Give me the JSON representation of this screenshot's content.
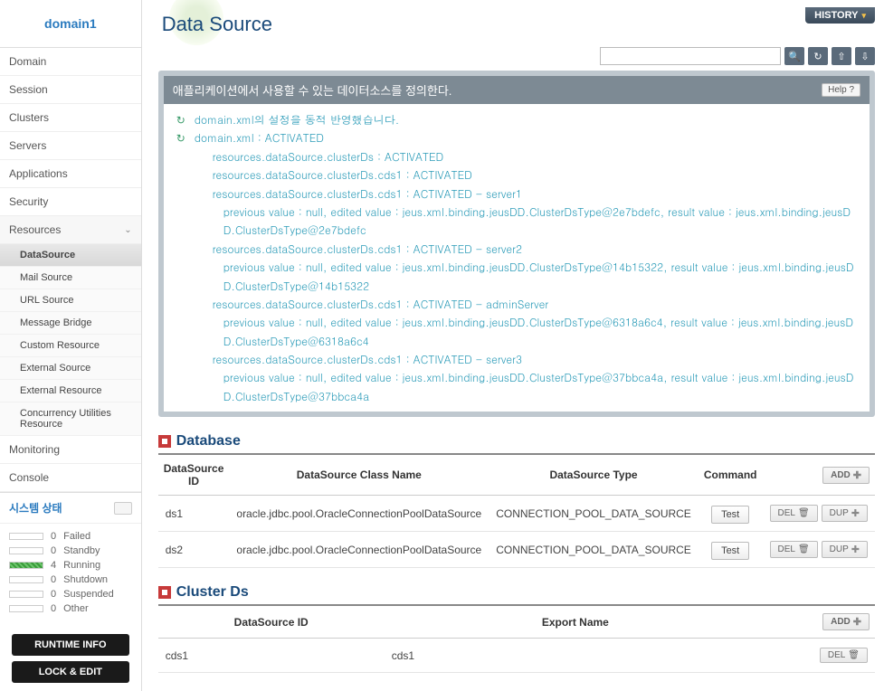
{
  "header": {
    "domain": "domain1",
    "page_title": "Data Source",
    "history": "HISTORY"
  },
  "nav": {
    "items": [
      "Domain",
      "Session",
      "Clusters",
      "Servers",
      "Applications",
      "Security",
      "Resources",
      "Monitoring",
      "Console"
    ],
    "resources_sub": [
      "DataSource",
      "Mail Source",
      "URL Source",
      "Message Bridge",
      "Custom Resource",
      "External Source",
      "External Resource",
      "Concurrency Utilities Resource"
    ]
  },
  "status": {
    "title": "시스템 상태",
    "rows": [
      {
        "count": "0",
        "label": "Failed"
      },
      {
        "count": "0",
        "label": "Standby"
      },
      {
        "count": "4",
        "label": "Running"
      },
      {
        "count": "0",
        "label": "Shutdown"
      },
      {
        "count": "0",
        "label": "Suspended"
      },
      {
        "count": "0",
        "label": "Other"
      }
    ],
    "runtime_btn": "RUNTIME INFO",
    "lock_btn": "LOCK & EDIT"
  },
  "panel": {
    "description": "애플리케이션에서 사용할 수 있는 데이터소스를 정의한다.",
    "help": "Help ?",
    "messages": [
      {
        "icon": true,
        "indent": 0,
        "text": "domain.xml의 설정을 동적 반영했습니다."
      },
      {
        "icon": true,
        "indent": 0,
        "text": "domain.xml : ACTIVATED"
      },
      {
        "icon": false,
        "indent": 1,
        "text": "resources.dataSource.clusterDs : ACTIVATED"
      },
      {
        "icon": false,
        "indent": 1,
        "text": "resources.dataSource.clusterDs.cds1 : ACTIVATED"
      },
      {
        "icon": false,
        "indent": 1,
        "text": "resources.dataSource.clusterDs.cds1 : ACTIVATED - server1"
      },
      {
        "icon": false,
        "indent": 2,
        "text": "previous value : null, edited value : jeus.xml.binding.jeusDD.ClusterDsType@2e7bdefc, result value : jeus.xml.binding.jeusDD.ClusterDsType@2e7bdefc"
      },
      {
        "icon": false,
        "indent": 1,
        "text": "resources.dataSource.clusterDs.cds1 : ACTIVATED - server2"
      },
      {
        "icon": false,
        "indent": 2,
        "text": "previous value : null, edited value : jeus.xml.binding.jeusDD.ClusterDsType@14b15322, result value : jeus.xml.binding.jeusDD.ClusterDsType@14b15322"
      },
      {
        "icon": false,
        "indent": 1,
        "text": "resources.dataSource.clusterDs.cds1 : ACTIVATED - adminServer"
      },
      {
        "icon": false,
        "indent": 2,
        "text": "previous value : null, edited value : jeus.xml.binding.jeusDD.ClusterDsType@6318a6c4, result value : jeus.xml.binding.jeusDD.ClusterDsType@6318a6c4"
      },
      {
        "icon": false,
        "indent": 1,
        "text": "resources.dataSource.clusterDs.cds1 : ACTIVATED - server3"
      },
      {
        "icon": false,
        "indent": 2,
        "text": "previous value : null, edited value : jeus.xml.binding.jeusDD.ClusterDsType@37bbca4a, result value : jeus.xml.binding.jeusDD.ClusterDsType@37bbca4a"
      }
    ]
  },
  "database": {
    "title": "Database",
    "headers": [
      "DataSource ID",
      "DataSource Class Name",
      "DataSource Type",
      "Command"
    ],
    "add": "ADD",
    "test": "Test",
    "del": "DEL",
    "dup": "DUP",
    "rows": [
      {
        "id": "ds1",
        "cls": "oracle.jdbc.pool.OracleConnectionPoolDataSource",
        "type": "CONNECTION_POOL_DATA_SOURCE"
      },
      {
        "id": "ds2",
        "cls": "oracle.jdbc.pool.OracleConnectionPoolDataSource",
        "type": "CONNECTION_POOL_DATA_SOURCE"
      }
    ]
  },
  "clusterds": {
    "title": "Cluster Ds",
    "headers": [
      "DataSource ID",
      "Export Name"
    ],
    "add": "ADD",
    "del": "DEL",
    "rows": [
      {
        "id": "cds1",
        "export": "cds1"
      }
    ]
  }
}
